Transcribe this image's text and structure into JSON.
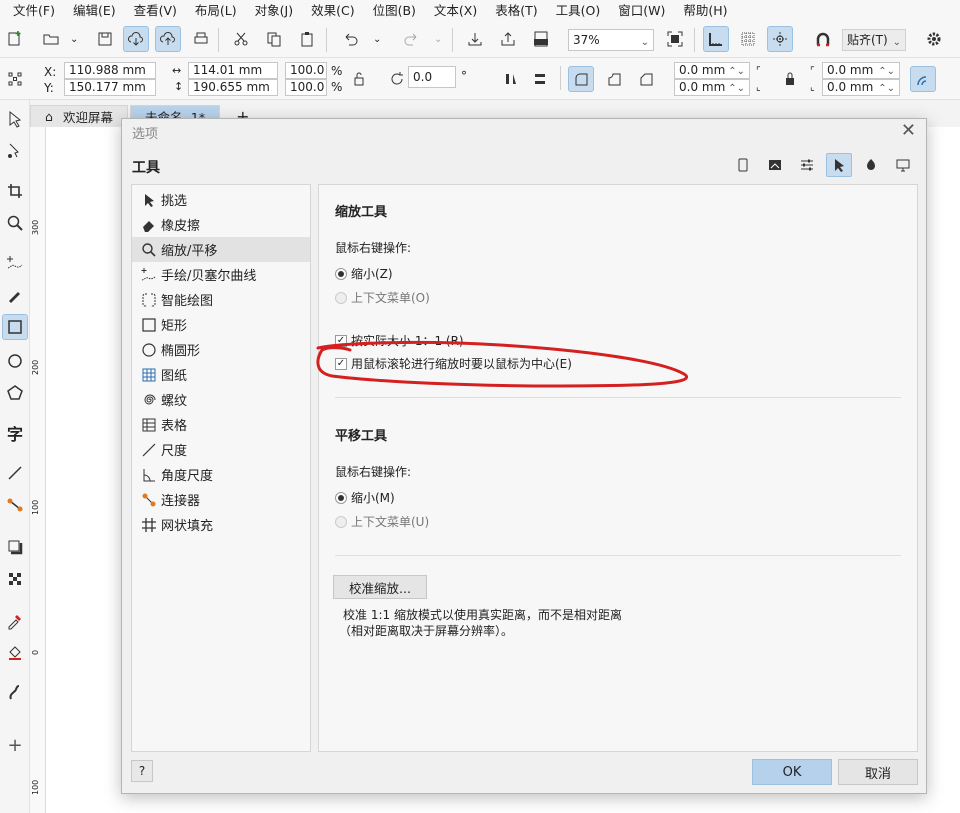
{
  "menu": [
    "文件(F)",
    "编辑(E)",
    "查看(V)",
    "布局(L)",
    "对象(J)",
    "效果(C)",
    "位图(B)",
    "文本(X)",
    "表格(T)",
    "工具(O)",
    "窗口(W)",
    "帮助(H)"
  ],
  "toolbar": {
    "zoom_value": "37%",
    "snap_label": "贴齐(T)"
  },
  "propbar": {
    "x_label": "X:",
    "y_label": "Y:",
    "x_value": "110.988 mm",
    "y_value": "150.177 mm",
    "w_value": "114.01 mm",
    "h_value": "190.655 mm",
    "scale_w": "100.0",
    "scale_h": "100.0",
    "percent": "%",
    "rotation": "0.0",
    "degree": "°",
    "corner1": "0.0 mm",
    "corner2": "0.0 mm",
    "corner3": "0.0 mm",
    "corner4": "0.0 mm"
  },
  "tabs": {
    "welcome": "欢迎屏幕",
    "document": "未命名 -1*",
    "add": "+"
  },
  "ruler_labels": [
    "300",
    "200",
    "100",
    "0",
    "100"
  ],
  "dialog": {
    "title": "选项",
    "heading": "工具",
    "nav": [
      "挑选",
      "橡皮擦",
      "缩放/平移",
      "手绘/贝塞尔曲线",
      "智能绘图",
      "矩形",
      "椭圆形",
      "图纸",
      "螺纹",
      "表格",
      "尺度",
      "角度尺度",
      "连接器",
      "网状填充"
    ],
    "zoom_section": {
      "title": "缩放工具",
      "right_click_label": "鼠标右键操作:",
      "opt_zoom_out": "缩小(Z)",
      "opt_context_menu": "上下文菜单(O)",
      "chk_actual_size": "按实际大小 1：1 (R)",
      "chk_center_mouse": "用鼠标滚轮进行缩放时要以鼠标为中心(E)"
    },
    "pan_section": {
      "title": "平移工具",
      "right_click_label": "鼠标右键操作:",
      "opt_zoom_out": "缩小(M)",
      "opt_context_menu": "上下文菜单(U)"
    },
    "calibrate_button": "校准缩放...",
    "calibrate_desc_1": "校准 1:1 缩放模式以使用真实距离，而不是相对距离",
    "calibrate_desc_2": "（相对距离取决于屏幕分辨率）。",
    "help_button": "?",
    "ok_button": "OK",
    "cancel_button": "取消"
  },
  "annotation_color": "#d42020"
}
